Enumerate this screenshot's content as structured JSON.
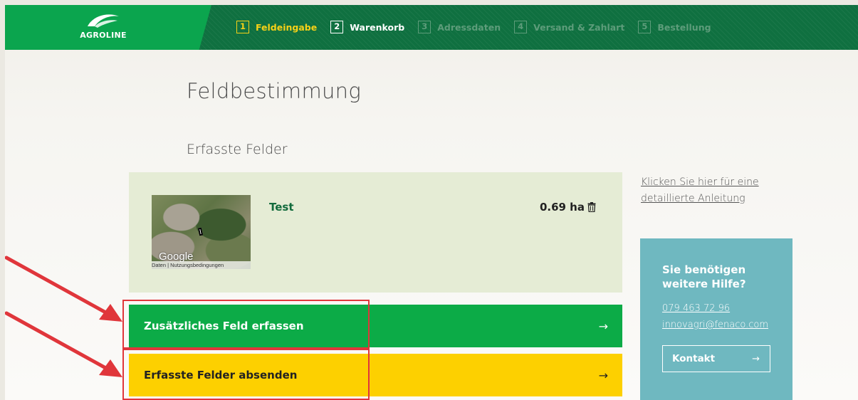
{
  "header": {
    "logo_text": "AGROLINE",
    "steps": [
      {
        "num": "1",
        "label": "Feldeingabe"
      },
      {
        "num": "2",
        "label": "Warenkorb"
      },
      {
        "num": "3",
        "label": "Adressdaten"
      },
      {
        "num": "4",
        "label": "Versand & Zahlart"
      },
      {
        "num": "5",
        "label": "Bestellung"
      }
    ]
  },
  "main": {
    "title": "Feldbestimmung",
    "subtitle": "Erfasste Felder",
    "field": {
      "name": "Test",
      "area": "0.69 ha",
      "map_brand": "Google",
      "map_attribution": "Daten | Nutzungsbedingungen"
    },
    "add_button": {
      "label": "Zusätzliches Feld erfassen",
      "arrow": "→"
    },
    "submit_button": {
      "label": "Erfasste Felder absenden",
      "arrow": "→"
    }
  },
  "sidebar": {
    "guide_link": "Klicken Sie hier für eine detaillierte Anleitung",
    "help_title": "Sie benötigen weitere Hilfe?",
    "phone": "079 463 72 96",
    "email": "innovagri@fenaco.com",
    "contact_button": {
      "label": "Kontakt",
      "arrow": "→"
    }
  },
  "colors": {
    "header_dark": "#0f7040",
    "header_light": "#0ba54e",
    "step_active": "#f7d117",
    "btn_green": "#0cab47",
    "btn_yellow": "#fdd000",
    "help_box": "#6fb8c0",
    "annotation_red": "#e0363b"
  }
}
